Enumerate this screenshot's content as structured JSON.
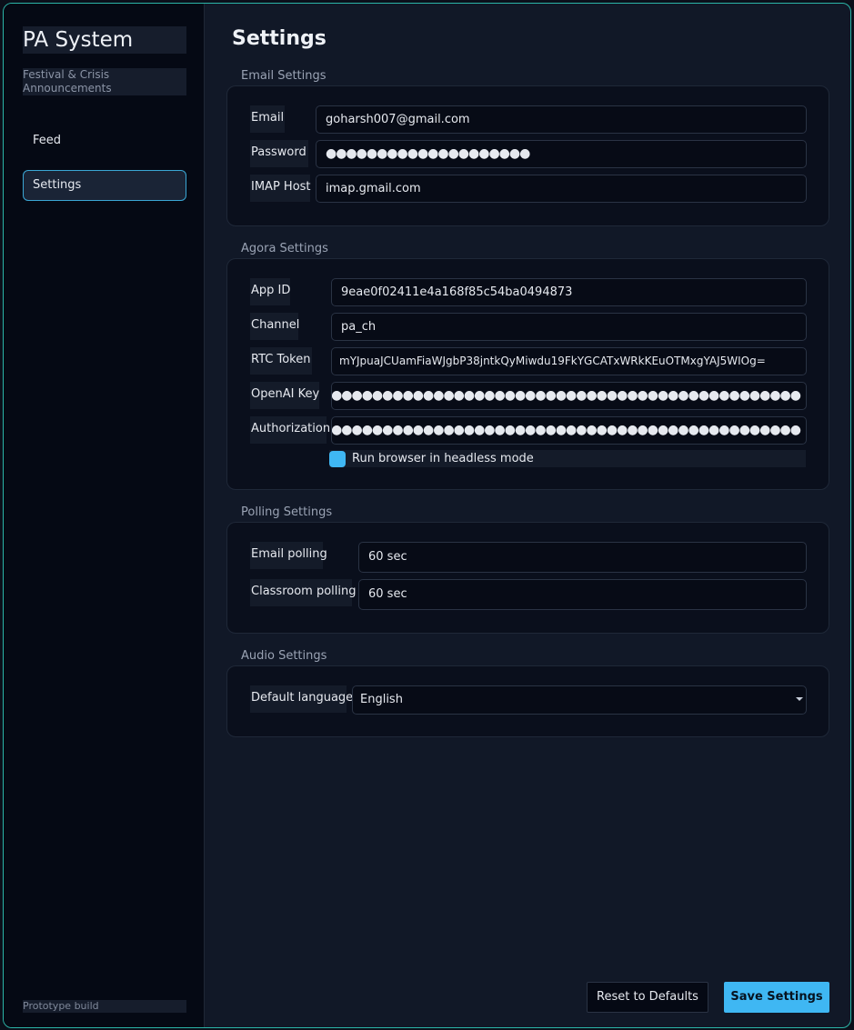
{
  "app": {
    "title": "PA System",
    "subtitle": "Festival & Crisis Announcements",
    "footer": "Prototype build"
  },
  "nav": {
    "items": [
      {
        "label": "Feed",
        "active": false
      },
      {
        "label": "Settings",
        "active": true
      }
    ]
  },
  "page": {
    "title": "Settings"
  },
  "email_settings": {
    "heading": "Email Settings",
    "email_label": "Email",
    "email_value": "goharsh007@gmail.com",
    "password_label": "Password",
    "password_value": "●●●●●●●●●●●●●●●●●●●●",
    "imap_label": "IMAP Host",
    "imap_value": "imap.gmail.com"
  },
  "agora_settings": {
    "heading": "Agora Settings",
    "app_id_label": "App ID",
    "app_id_value": "9eae0f02411e4a168f85c54ba0494873",
    "channel_label": "Channel",
    "channel_value": "pa_ch",
    "rtc_label": "RTC Token",
    "rtc_value": "mYJpuaJCUamFiaWJgbP38jntkQyMiwdu19FkYGCATxWRkKEuOTMxgYAJ5WIOg=",
    "openai_label": "OpenAI Key",
    "openai_value": "●●●●●●●●●●●●●●●●●●●●●●●●●●●●●●●●●●●●●●●●●●●●●●●●●●●●●●●●",
    "auth_label": "Authorization",
    "auth_value": "●●●●●●●●●●●●●●●●●●●●●●●●●●●●●●●●●●●●●●●●●●●●●●●●●●●●●●●●",
    "headless_label": "Run browser in headless mode",
    "headless_checked": true
  },
  "polling_settings": {
    "heading": "Polling Settings",
    "email_label": "Email polling",
    "email_value": "60 sec",
    "classroom_label": "Classroom polling",
    "classroom_value": "60 sec"
  },
  "audio_settings": {
    "heading": "Audio Settings",
    "language_label": "Default language",
    "language_value": "English"
  },
  "actions": {
    "reset_label": "Reset to Defaults",
    "save_label": "Save Settings"
  },
  "colors": {
    "accent": "#3fb7f3",
    "border": "#2bb5a8"
  }
}
